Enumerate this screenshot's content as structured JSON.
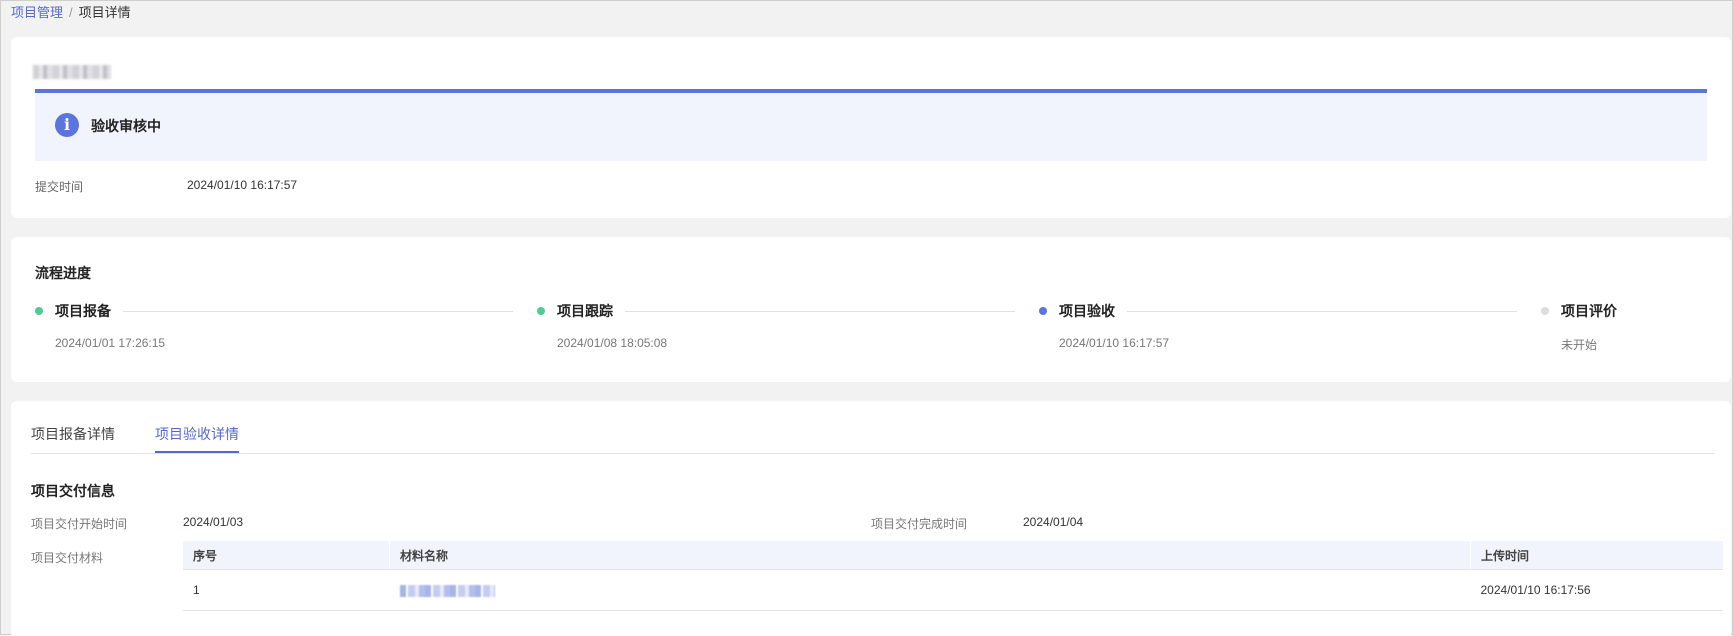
{
  "breadcrumb": {
    "parent": "项目管理",
    "separator": "/",
    "current": "项目详情"
  },
  "status_card": {
    "status_text": "验收审核中",
    "info_icon": "info-icon",
    "submit_time_label": "提交时间",
    "submit_time_value": "2024/01/10 16:17:57"
  },
  "process": {
    "title": "流程进度",
    "steps": [
      {
        "title": "项目报备",
        "time": "2024/01/01 17:26:15",
        "state": "done",
        "color": "#4ecb96"
      },
      {
        "title": "项目跟踪",
        "time": "2024/01/08 18:05:08",
        "state": "done",
        "color": "#4ecb96"
      },
      {
        "title": "项目验收",
        "time": "2024/01/10 16:17:57",
        "state": "current",
        "color": "#5a75dc"
      },
      {
        "title": "项目评价",
        "time": "未开始",
        "state": "pending",
        "color": "#dddddd"
      }
    ]
  },
  "detail": {
    "tabs": [
      {
        "label": "项目报备详情",
        "active": false
      },
      {
        "label": "项目验收详情",
        "active": true
      }
    ],
    "delivery": {
      "title": "项目交付信息",
      "start_label": "项目交付开始时间",
      "start_value": "2024/01/03",
      "end_label": "项目交付完成时间",
      "end_value": "2024/01/04",
      "materials_label": "项目交付材料",
      "table": {
        "headers": [
          "序号",
          "材料名称",
          "上传时间"
        ],
        "rows": [
          {
            "index": "1",
            "upload_time": "2024/01/10 16:17:56"
          }
        ]
      }
    }
  },
  "colors": {
    "accent": "#5468d4",
    "banner_bg": "#f1f4fd",
    "done": "#4ecb96",
    "current": "#5a75dc",
    "pending": "#dddddd"
  }
}
